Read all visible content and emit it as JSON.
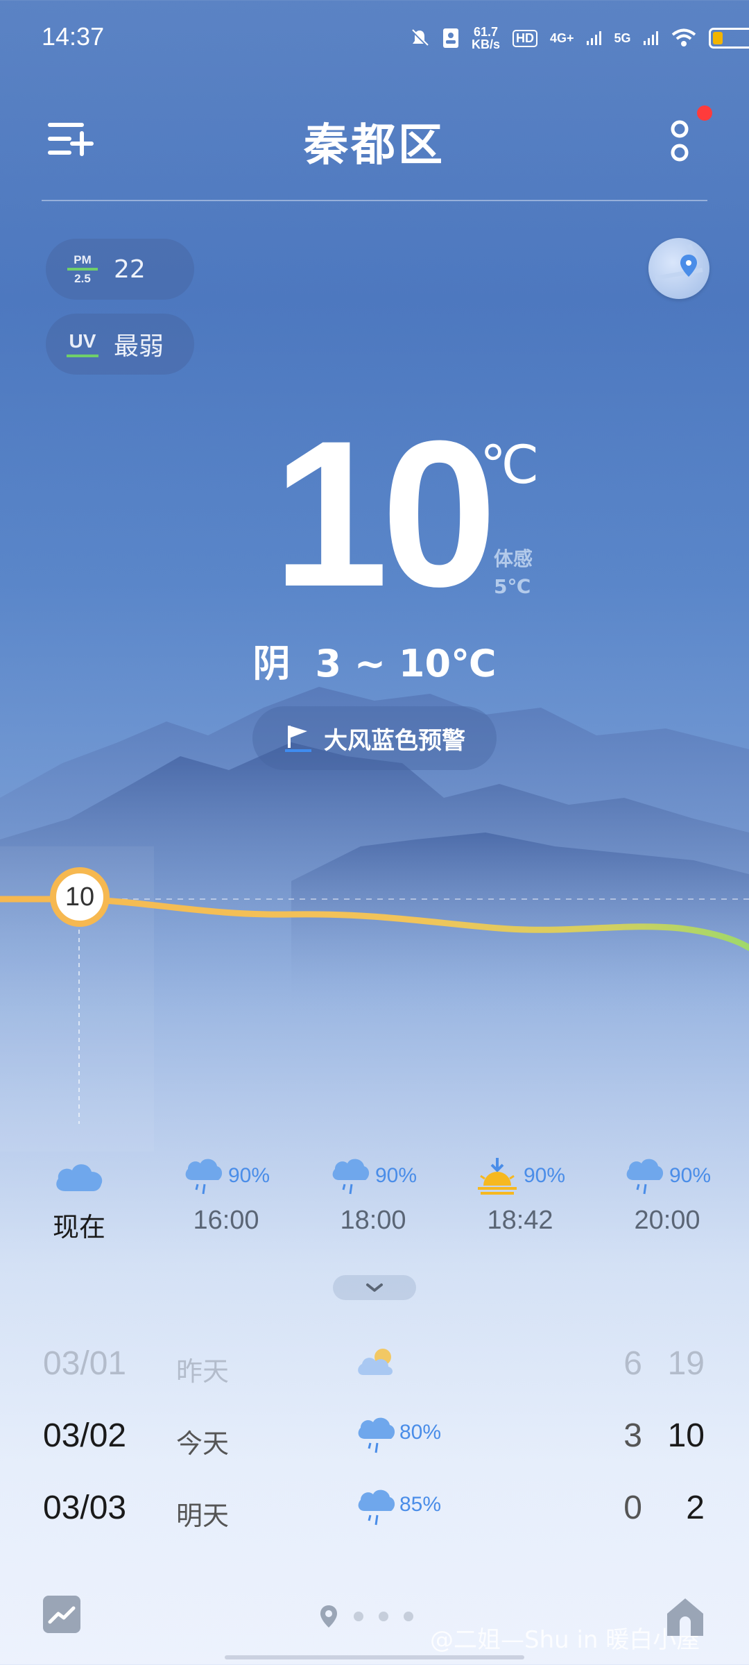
{
  "status_bar": {
    "time": "14:37",
    "net_speed_value": "61.7",
    "net_speed_unit": "KB/s",
    "hd_label": "HD",
    "net_4g_label": "4G+",
    "net_5g_label": "5G",
    "battery_level": 0.25
  },
  "header": {
    "city": "秦都区"
  },
  "air": {
    "pm_label_top": "PM",
    "pm_label_bottom": "2.5",
    "pm_value": "22",
    "uv_label": "UV",
    "uv_value": "最弱"
  },
  "current": {
    "temperature": "10",
    "unit": "℃",
    "feels_label": "体感",
    "feels_value": "5℃",
    "condition": "阴",
    "range": "3 ~ 10℃",
    "alert": "大风蓝色预警",
    "now_badge": "10"
  },
  "hourly": [
    {
      "time": "现在",
      "icon": "cloud-icon",
      "pct": ""
    },
    {
      "time": "16:00",
      "icon": "rain-cloud-icon",
      "pct": "90%"
    },
    {
      "time": "18:00",
      "icon": "rain-cloud-icon",
      "pct": "90%"
    },
    {
      "time": "18:42",
      "icon": "sunset-icon",
      "pct": "90%"
    },
    {
      "time": "20:00",
      "icon": "rain-cloud-icon",
      "pct": "90%"
    }
  ],
  "daily": [
    {
      "date": "03/01",
      "label": "昨天",
      "icon": "partly-cloudy-icon",
      "pct": "",
      "low": "6",
      "high": "19"
    },
    {
      "date": "03/02",
      "label": "今天",
      "icon": "rain-cloud-icon",
      "pct": "80%",
      "low": "3",
      "high": "10"
    },
    {
      "date": "03/03",
      "label": "明天",
      "icon": "rain-cloud-icon",
      "pct": "85%",
      "low": "0",
      "high": "2"
    }
  ],
  "footer": {
    "watermark": "@二姐—Shu in 暖白小屋"
  },
  "colors": {
    "accent_orange": "#f6b850",
    "accent_green": "#9fd86a",
    "rain_blue": "#4a8de8",
    "alert_red": "#ff3b3b"
  }
}
